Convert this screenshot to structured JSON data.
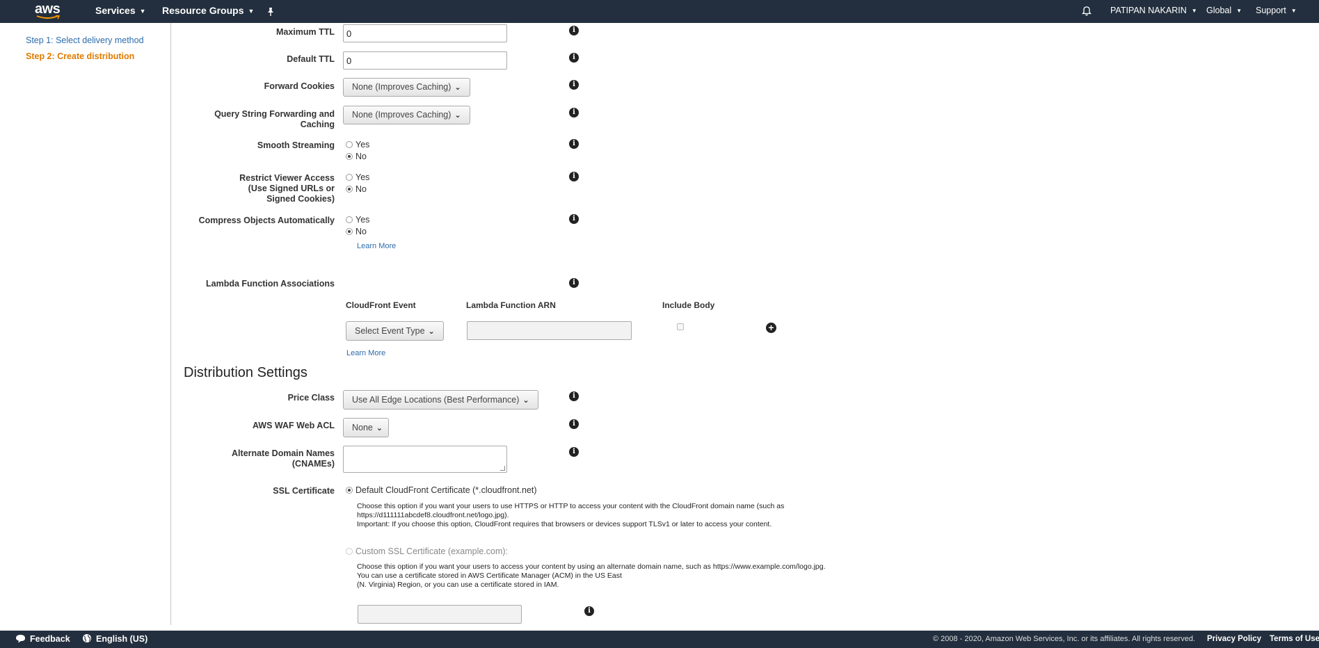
{
  "nav": {
    "logo": "aws",
    "services": "Services",
    "resource_groups": "Resource Groups",
    "pin_icon": "pin-icon",
    "bell_icon": "bell-icon",
    "user": "PATIPAN NAKARIN",
    "region": "Global",
    "support": "Support"
  },
  "sidebar": {
    "step1": "Step 1: Select delivery method",
    "step2": "Step 2: Create distribution"
  },
  "form": {
    "max_ttl_label": "Maximum TTL",
    "max_ttl_value": "0",
    "default_ttl_label": "Default TTL",
    "default_ttl_value": "0",
    "forward_cookies_label": "Forward Cookies",
    "forward_cookies_value": "None (Improves Caching)",
    "query_string_label_1": "Query String Forwarding and",
    "query_string_label_2": "Caching",
    "query_string_value": "None (Improves Caching)",
    "smooth_streaming_label": "Smooth Streaming",
    "restrict_label_1": "Restrict Viewer Access",
    "restrict_label_2": "(Use Signed URLs or",
    "restrict_label_3": "Signed Cookies)",
    "compress_label": "Compress Objects Automatically",
    "yes": "Yes",
    "no": "No",
    "learn_more": "Learn More",
    "lambda_label": "Lambda Function Associations",
    "cf_event_header": "CloudFront Event",
    "lambda_arn_header": "Lambda Function ARN",
    "include_body_header": "Include Body",
    "event_type_value": "Select Event Type",
    "lambda_arn_value": ""
  },
  "distribution": {
    "title": "Distribution Settings",
    "price_class_label": "Price Class",
    "price_class_value": "Use All Edge Locations (Best Performance)",
    "waf_label": "AWS WAF Web ACL",
    "waf_value": "None",
    "cnames_label_1": "Alternate Domain Names",
    "cnames_label_2": "(CNAMEs)",
    "ssl_label": "SSL Certificate",
    "ssl_default": "Default CloudFront Certificate (*.cloudfront.net)",
    "ssl_default_desc_1": "Choose this option if you want your users to use HTTPS or HTTP to access your content with the CloudFront domain name (such as",
    "ssl_default_desc_2": "https://d111111abcdef8.cloudfront.net/logo.jpg).",
    "ssl_default_desc_3": "Important: If you choose this option, CloudFront requires that browsers or devices support TLSv1 or later to access your content.",
    "ssl_custom": "Custom SSL Certificate (example.com):",
    "ssl_custom_desc_1": "Choose this option if you want your users to access your content by using an alternate domain name, such as https://www.example.com/logo.jpg.",
    "ssl_custom_desc_2": "You can use a certificate stored in AWS Certificate Manager (ACM) in the US East",
    "ssl_custom_desc_3": "(N. Virginia) Region, or you can use a certificate stored in IAM."
  },
  "footer": {
    "feedback": "Feedback",
    "language": "English (US)",
    "copyright": "© 2008 - 2020, Amazon Web Services, Inc. or its affiliates. All rights reserved.",
    "privacy": "Privacy Policy",
    "terms": "Terms of Use"
  },
  "colors": {
    "nav_bg": "#232f3e",
    "link": "#2c6bac",
    "active_step": "#e07b00",
    "logo_smile": "#ff9900"
  }
}
